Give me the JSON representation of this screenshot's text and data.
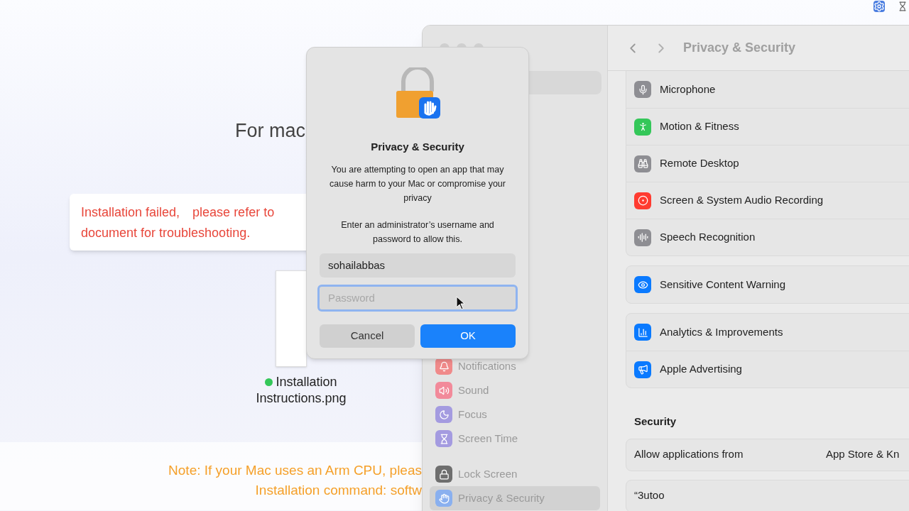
{
  "background_page": {
    "heading": "For mac",
    "error_tooltip_lines": [
      "Installation failed,　please refer to",
      "document for troubleshooting."
    ],
    "file": {
      "name_lines": [
        "Installation",
        "Instructions.png"
      ]
    },
    "note_lines": [
      "Note: If your Mac uses an Arm CPU, pleas",
      "Installation command: softw"
    ]
  },
  "settings_window": {
    "title": "Privacy & Security",
    "sidebar": {
      "items": [
        {
          "label": "Notifications",
          "color": "#f08a8a",
          "selected": false
        },
        {
          "label": "Sound",
          "color": "#f28a9a",
          "selected": false
        },
        {
          "label": "Focus",
          "color": "#a49be0",
          "selected": false
        },
        {
          "label": "Screen Time",
          "color": "#a49be0",
          "selected": false
        },
        {
          "label": "Lock Screen",
          "color": "#6e6e6e",
          "selected": false
        },
        {
          "label": "Privacy & Security",
          "color": "#8ab0ef",
          "selected": true
        }
      ]
    },
    "groups": [
      {
        "rows": [
          {
            "label": "Microphone",
            "color": "#8e8e93"
          },
          {
            "label": "Motion & Fitness",
            "color": "#34c759"
          },
          {
            "label": "Remote Desktop",
            "color": "#8e8e93"
          },
          {
            "label": "Screen & System Audio Recording",
            "color": "#ff3b30"
          },
          {
            "label": "Speech Recognition",
            "color": "#8e8e93"
          }
        ]
      },
      {
        "rows": [
          {
            "label": "Sensitive Content Warning",
            "color": "#0a7aff"
          }
        ]
      },
      {
        "rows": [
          {
            "label": "Analytics & Improvements",
            "color": "#0a7aff"
          },
          {
            "label": "Apple Advertising",
            "color": "#0a7aff"
          }
        ]
      }
    ],
    "security": {
      "heading": "Security",
      "rows": [
        {
          "label": "Allow applications from",
          "value": "App Store & Kn"
        },
        {
          "label": "“3utoo"
        }
      ]
    }
  },
  "dialog": {
    "title": "Privacy & Security",
    "message": "You are attempting to open an app that may cause harm to your Mac or compromise your privacy",
    "prompt": "Enter an administrator’s username and password to allow this.",
    "username": {
      "value": "sohailabbas"
    },
    "password": {
      "placeholder": "Password",
      "focused": true
    },
    "buttons": [
      {
        "label": "Cancel",
        "default": false
      },
      {
        "label": "OK",
        "default": true
      }
    ]
  }
}
